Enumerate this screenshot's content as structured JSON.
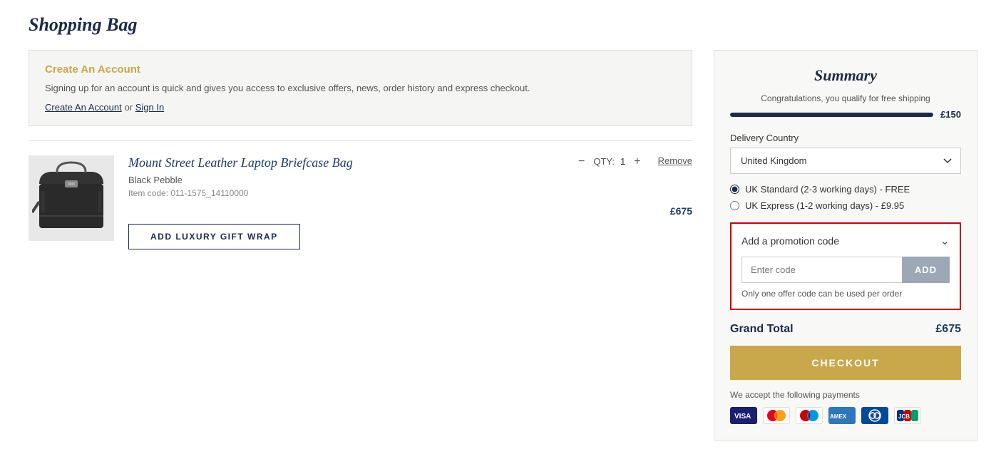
{
  "page": {
    "title": "Shopping Bag"
  },
  "account_banner": {
    "title": "Create An Account",
    "text": "Signing up for an account is quick and gives you access to exclusive offers, news, order history and express checkout.",
    "create_link": "Create An Account",
    "or_text": " or ",
    "sign_in_link": "Sign In"
  },
  "cart": {
    "item": {
      "name": "Mount Street Leather Laptop Briefcase Bag",
      "variant": "Black Pebble",
      "item_code": "Item code: 011-1575_14110000",
      "qty_label": "QTY:",
      "qty_value": "1",
      "price": "£675",
      "remove_label": "Remove",
      "gift_wrap_btn": "ADD LUXURY GIFT WRAP",
      "qty_minus": "−",
      "qty_plus": "+"
    }
  },
  "summary": {
    "title": "Summary",
    "free_shipping_text": "Congratulations, you qualify for free shipping",
    "progress_amount": "£150",
    "progress_pct": 100,
    "delivery_country_label": "Delivery Country",
    "delivery_country_value": "United Kingdom",
    "delivery_options": [
      {
        "id": "standard",
        "label": "UK Standard (2-3 working days) - FREE",
        "checked": true
      },
      {
        "id": "express",
        "label": "UK Express (1-2 working days) - £9.95",
        "checked": false
      }
    ],
    "promo": {
      "header": "Add a promotion code",
      "input_placeholder": "Enter code",
      "add_btn": "ADD",
      "note": "Only one offer code can be used per order"
    },
    "grand_total_label": "Grand Total",
    "grand_total_amount": "£675",
    "checkout_btn": "CHECKOUT",
    "payment_text": "We accept the following payments",
    "payment_icons": [
      "VISA",
      "MC",
      "Maestro",
      "AMEX",
      "Diners",
      "JCB"
    ]
  }
}
